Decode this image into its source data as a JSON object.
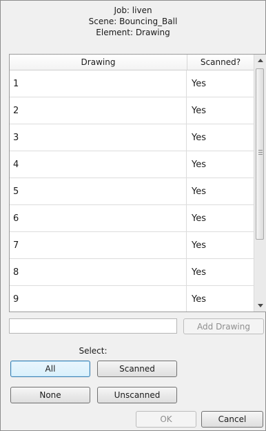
{
  "header": {
    "job": "Job: liven",
    "scene": "Scene: Bouncing_Ball",
    "element": "Element: Drawing"
  },
  "table": {
    "columns": [
      "Drawing",
      "Scanned?"
    ],
    "rows": [
      {
        "drawing": "1",
        "scanned": "Yes"
      },
      {
        "drawing": "2",
        "scanned": "Yes"
      },
      {
        "drawing": "3",
        "scanned": "Yes"
      },
      {
        "drawing": "4",
        "scanned": "Yes"
      },
      {
        "drawing": "5",
        "scanned": "Yes"
      },
      {
        "drawing": "6",
        "scanned": "Yes"
      },
      {
        "drawing": "7",
        "scanned": "Yes"
      },
      {
        "drawing": "8",
        "scanned": "Yes"
      },
      {
        "drawing": "9",
        "scanned": "Yes"
      }
    ]
  },
  "drawing_input": {
    "value": "",
    "placeholder": ""
  },
  "buttons": {
    "add_drawing": "Add Drawing",
    "all": "All",
    "scanned": "Scanned",
    "none": "None",
    "unscanned": "Unscanned",
    "ok": "OK",
    "cancel": "Cancel"
  },
  "select_label": "Select:",
  "icons": {
    "scroll_up": "arrow-up-icon",
    "scroll_down": "arrow-down-icon",
    "thumb_grip": "grip-icon"
  }
}
